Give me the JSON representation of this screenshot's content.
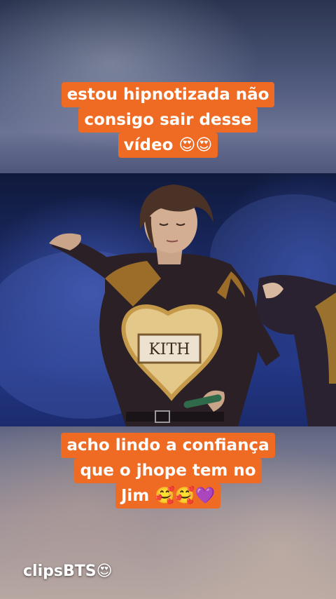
{
  "caption_top": {
    "lines": [
      "estou hipnotizada não",
      "consigo sair desse",
      "vídeo 😍😍"
    ]
  },
  "caption_bottom": {
    "lines": [
      "acho lindo a confiança",
      "que o jhope tem no",
      "Jim 🥰🥰💜"
    ]
  },
  "shirt_logo": "KITH",
  "watermark": "clipsBTS😍",
  "colors": {
    "caption_background": "#ef6a23",
    "caption_text": "#ffffff",
    "stage_background": "#1b2a66"
  }
}
